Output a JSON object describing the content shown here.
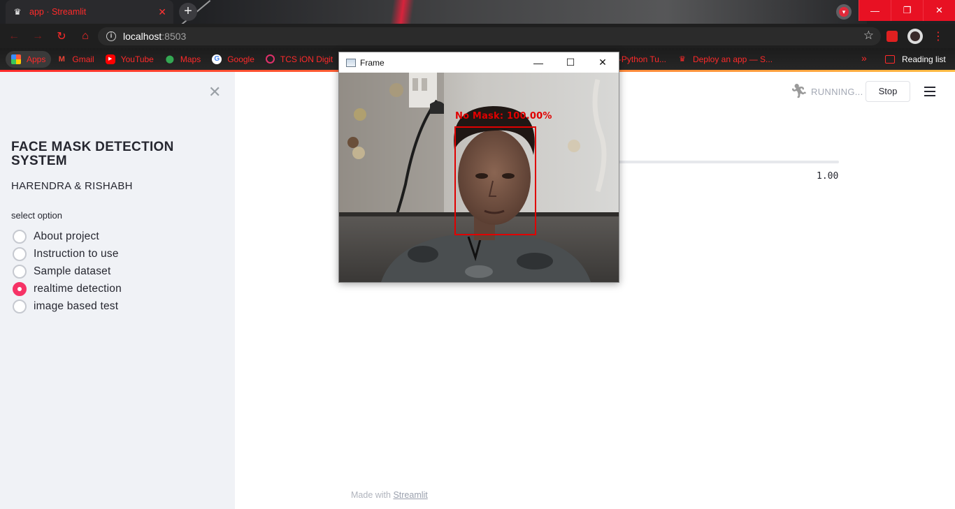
{
  "browser": {
    "tab_title": "app · Streamlit",
    "tab_close": "✕",
    "new_tab": "+",
    "url_host": "localhost",
    "url_port": ":8503",
    "window_controls": {
      "minimize": "—",
      "restore": "❐",
      "close": "✕"
    }
  },
  "bookmarks": [
    {
      "label": "Apps",
      "icon": "apps-grid-icon"
    },
    {
      "label": "Gmail",
      "icon": "gmail-icon"
    },
    {
      "label": "YouTube",
      "icon": "youtube-icon"
    },
    {
      "label": "Maps",
      "icon": "maps-pin-icon"
    },
    {
      "label": "Google",
      "icon": "google-icon"
    },
    {
      "label": "TCS iON Digit",
      "icon": "tcs-icon"
    },
    {
      "label": "oCV-Python Tu...",
      "icon": "crown-icon"
    },
    {
      "label": "Deploy an app — S...",
      "icon": "crown-icon"
    }
  ],
  "bookmarks_more": "»",
  "reading_list": "Reading list",
  "sidebar": {
    "title": "FACE MASK DETECTION SYSTEM",
    "subtitle": "HARENDRA & RISHABH",
    "select_label": "select option",
    "options": [
      {
        "label": "About project",
        "selected": false
      },
      {
        "label": "Instruction to use",
        "selected": false
      },
      {
        "label": "Sample dataset",
        "selected": false
      },
      {
        "label": "realtime detection",
        "selected": true
      },
      {
        "label": "image based test",
        "selected": false
      }
    ]
  },
  "header": {
    "status": "RUNNING...",
    "stop_label": "Stop"
  },
  "slider": {
    "max_label": "1.00"
  },
  "footer": {
    "prefix": "Made with ",
    "link": "Streamlit"
  },
  "cv_window": {
    "title": "Frame",
    "detection_label": "No Mask: 100.00%",
    "box_color": "#e00000"
  },
  "colors": {
    "accent": "#f63366",
    "chrome_red": "#ff2a2a",
    "sidebar_bg": "#f0f2f6"
  }
}
